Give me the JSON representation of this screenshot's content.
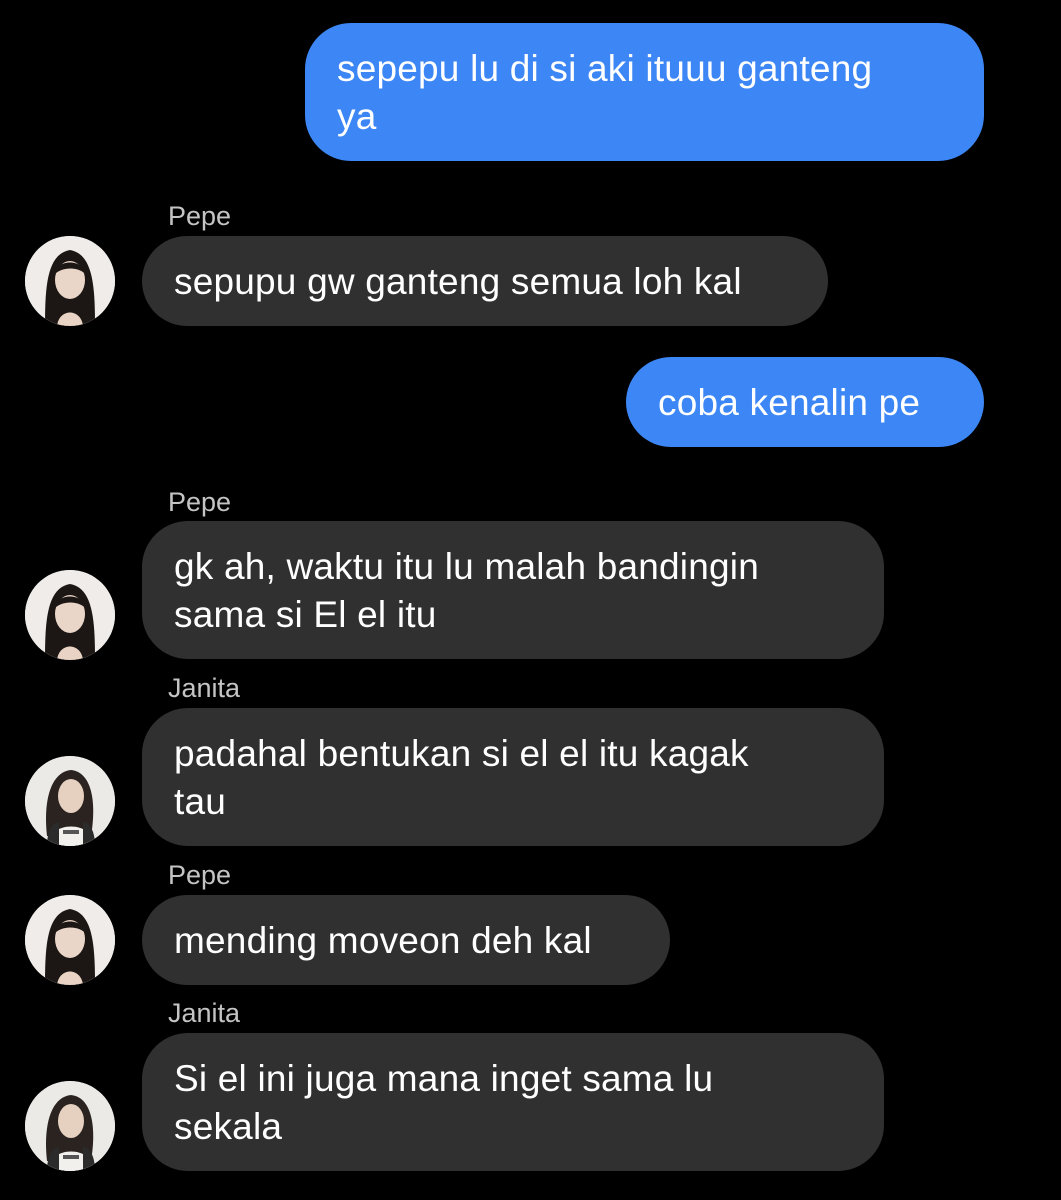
{
  "colors": {
    "background": "#000000",
    "outgoing_bubble": "#3c86f5",
    "incoming_bubble": "#303030",
    "sender_name": "#c4c4c4"
  },
  "messages": [
    {
      "direction": "outgoing",
      "text": "sepepu lu di si aki ituuu ganteng\nya"
    },
    {
      "direction": "incoming",
      "sender": "Pepe",
      "avatar": "pepe-avatar",
      "text": "sepupu gw ganteng semua loh kal"
    },
    {
      "direction": "outgoing",
      "text": "coba kenalin pe"
    },
    {
      "direction": "incoming",
      "sender": "Pepe",
      "avatar": "pepe-avatar",
      "text": "gk ah, waktu itu lu malah bandingin\nsama si El el itu"
    },
    {
      "direction": "incoming",
      "sender": "Janita",
      "avatar": "janita-avatar",
      "text": "padahal bentukan si el el itu kagak\ntau"
    },
    {
      "direction": "incoming",
      "sender": "Pepe",
      "avatar": "pepe-avatar",
      "text": "mending moveon deh kal"
    },
    {
      "direction": "incoming",
      "sender": "Janita",
      "avatar": "janita-avatar",
      "text": "Si el ini juga mana inget sama lu\nsekala"
    }
  ]
}
